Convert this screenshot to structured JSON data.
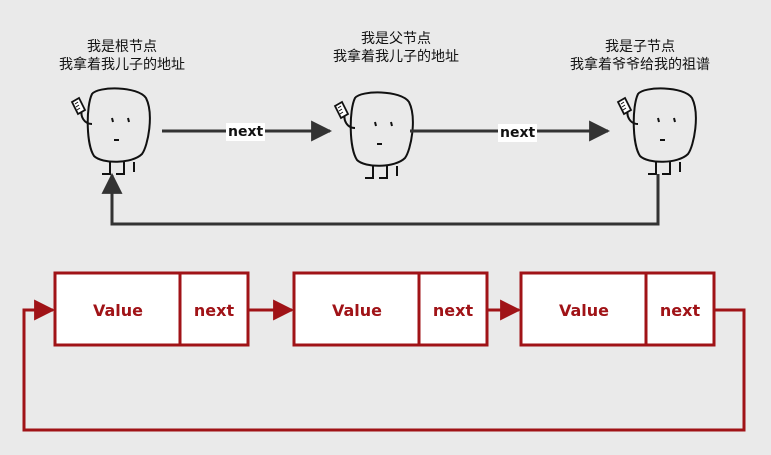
{
  "top": {
    "nodes": [
      {
        "role": "root",
        "line1": "我是根节点",
        "line2": "我拿着我儿子的地址"
      },
      {
        "role": "parent",
        "line1": "我是父节点",
        "line2": "我拿着我儿子的地址"
      },
      {
        "role": "child",
        "line1": "我是子节点",
        "line2": "我拿着爷爷给我的祖谱"
      }
    ],
    "arrow_labels": [
      "next",
      "next"
    ]
  },
  "bottom": {
    "nodes": [
      {
        "value_label": "Value",
        "next_label": "next"
      },
      {
        "value_label": "Value",
        "next_label": "next"
      },
      {
        "value_label": "Value",
        "next_label": "next"
      }
    ]
  },
  "colors": {
    "background": "#eaeaea",
    "list_red": "#a01317",
    "node_fill": "#ffffff",
    "dark_line": "#333333"
  },
  "icons": [
    "stick-figure-holding-paper-icon"
  ]
}
